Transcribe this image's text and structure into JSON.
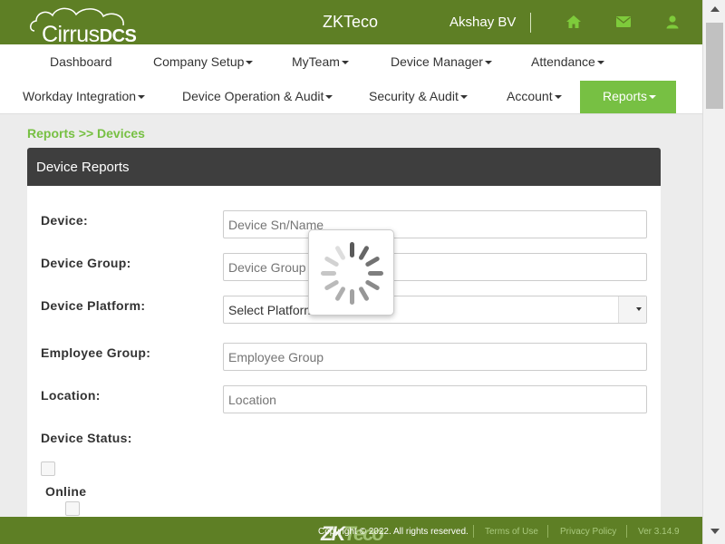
{
  "header": {
    "logo_main": "Cirrus",
    "logo_bold": "DCS",
    "brand": "ZKTeco",
    "user_name": "Akshay BV",
    "icons": [
      "home-icon",
      "envelope-icon",
      "user-icon"
    ]
  },
  "nav": {
    "row1": [
      "Dashboard",
      "Company Setup",
      "MyTeam",
      "Device Manager",
      "Attendance"
    ],
    "row2": [
      "Workday Integration",
      "Device Operation & Audit",
      "Security & Audit",
      "Account",
      "Reports"
    ],
    "active": "Reports"
  },
  "breadcrumb": "Reports >> Devices",
  "panel": {
    "title": "Device Reports",
    "fields": {
      "device_label": "Device:",
      "device_placeholder": "Device Sn/Name",
      "device_group_label": "Device Group:",
      "device_group_placeholder": "Device Group",
      "platform_label": "Device Platform:",
      "platform_value": "Select Platform",
      "employee_group_label": "Employee Group:",
      "employee_group_placeholder": "Employee Group",
      "location_label": "Location:",
      "location_placeholder": "Location",
      "status_label": "Device Status:",
      "online_label": "Online"
    }
  },
  "loading": true,
  "footer": {
    "copyright": "Copyright © 2022. All rights reserved.",
    "terms": "Terms of Use",
    "privacy": "Privacy Policy",
    "version": "Ver 3.14.9",
    "logo_a": "ZK",
    "logo_b": "Teco"
  },
  "colors": {
    "header_green": "#5e7f25",
    "accent_green": "#77c043",
    "panel_header": "#3e3e3e"
  }
}
